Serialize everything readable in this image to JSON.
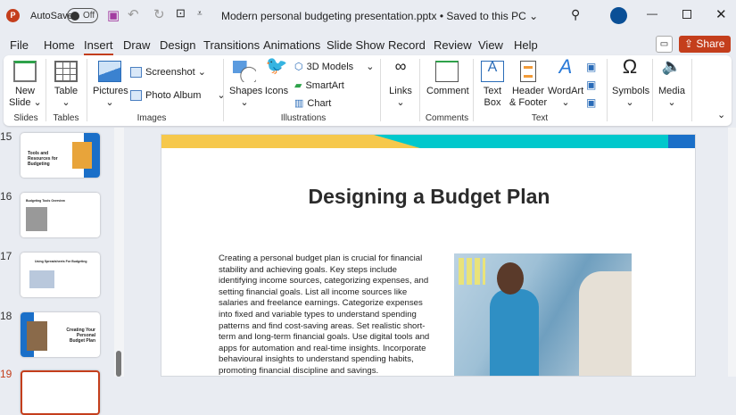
{
  "titlebar": {
    "app_icon": "P",
    "autosave_label": "AutoSave",
    "autosave_state": "Off",
    "doc_title": "Modern personal budgeting presentation.pptx • Saved to this PC ⌄"
  },
  "tabs": [
    "File",
    "Home",
    "Insert",
    "Draw",
    "Design",
    "Transitions",
    "Animations",
    "Slide Show",
    "Record",
    "Review",
    "View",
    "Help"
  ],
  "active_tab": "Insert",
  "share_label": "Share",
  "ribbon": {
    "new_slide": "New\nSlide ⌄",
    "table": "Table",
    "pictures": "Pictures",
    "screenshot": "Screenshot ⌄",
    "photo_album": "Photo Album",
    "shapes": "Shapes",
    "icons": "Icons",
    "models3d": "3D Models",
    "smartart": "SmartArt",
    "chart": "Chart",
    "links": "Links",
    "comment": "Comment",
    "text_box": "Text\nBox",
    "header_footer": "Header\n& Footer",
    "wordart": "WordArt",
    "symbols": "Symbols",
    "media": "Media",
    "groups": {
      "slides": "Slides",
      "tables": "Tables",
      "images": "Images",
      "illustrations": "Illustrations",
      "comments": "Comments",
      "text": "Text"
    }
  },
  "thumbnails": [
    {
      "num": "15",
      "title": "Tools and Resources for Budgeting"
    },
    {
      "num": "16",
      "title": "Budgeting Tools Overview"
    },
    {
      "num": "17",
      "title": "Using Spreadsheets For Budgeting"
    },
    {
      "num": "18",
      "title": "Creating Your Personal Budget Plan"
    },
    {
      "num": "19"
    }
  ],
  "slide": {
    "title": "Designing a Budget Plan",
    "body": "Creating a personal budget plan is crucial for financial stability and achieving goals. Key steps include identifying income sources, categorizing expenses, and setting financial goals. List all income sources like salaries and freelance earnings. Categorize expenses into fixed and variable types to understand spending patterns and find cost-saving areas. Set realistic short-term and long-term financial goals. Use digital tools and apps for automation and real-time insights. Incorporate behavioural insights to understand spending habits, promoting financial discipline and savings."
  },
  "colors": {
    "accent": "#c43e1c",
    "yellow": "#f6c84c",
    "teal": "#00c8cc",
    "blue": "#1a6fc8"
  }
}
